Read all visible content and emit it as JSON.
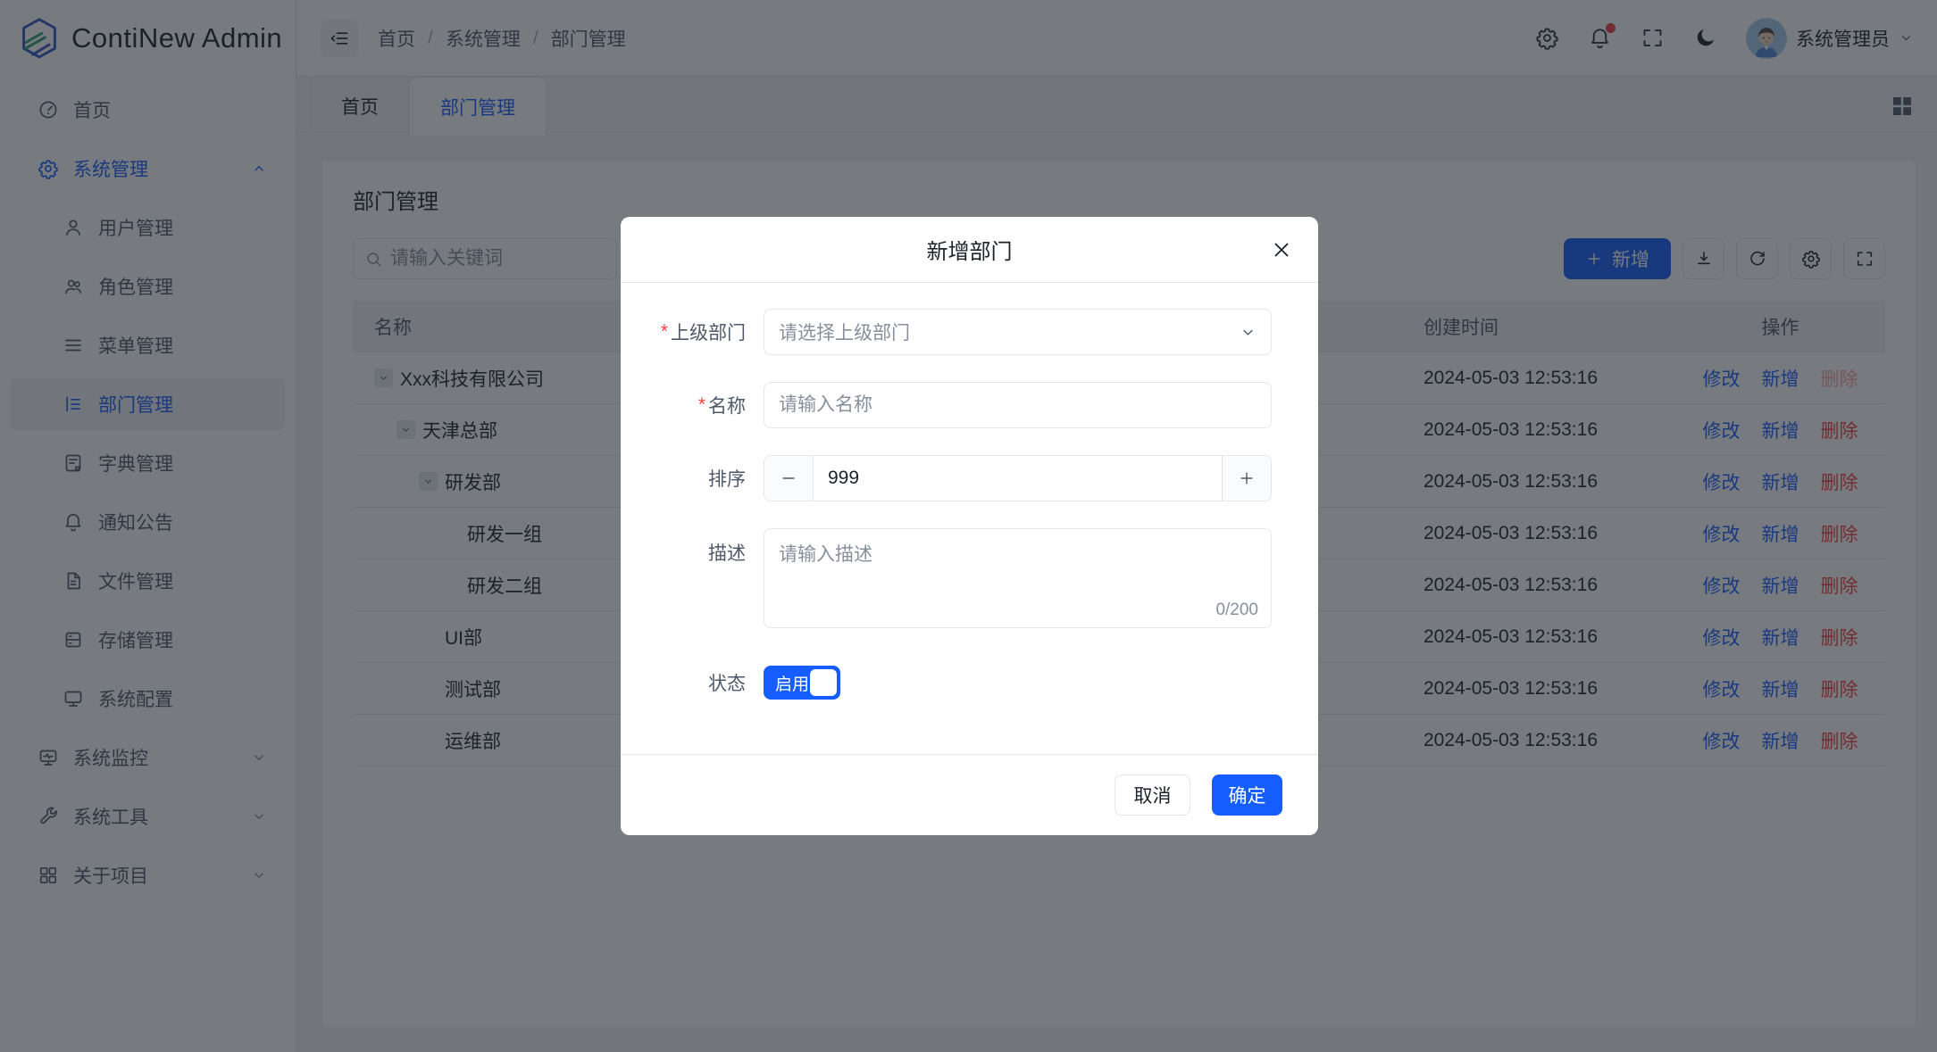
{
  "app": {
    "title": "ContiNew Admin"
  },
  "colors": {
    "primary": "#165DFF",
    "danger": "#F53F3F"
  },
  "breadcrumb": {
    "items": [
      "首页",
      "系统管理",
      "部门管理"
    ],
    "separator": "/"
  },
  "header": {
    "icons": [
      "settings-icon",
      "notification-icon",
      "fullscreen-icon",
      "dark-mode-icon"
    ],
    "user": {
      "name": "系统管理员"
    }
  },
  "tabs": {
    "items": [
      {
        "label": "首页"
      },
      {
        "label": "部门管理"
      }
    ]
  },
  "sidebar": {
    "items": [
      {
        "label": "首页",
        "icon": "dashboard",
        "level": 0
      },
      {
        "label": "系统管理",
        "icon": "gear",
        "level": 0,
        "active": true,
        "expanded": true
      },
      {
        "label": "用户管理",
        "icon": "user",
        "level": 1
      },
      {
        "label": "角色管理",
        "icon": "users",
        "level": 1
      },
      {
        "label": "菜单管理",
        "icon": "menu",
        "level": 1
      },
      {
        "label": "部门管理",
        "icon": "tree",
        "level": 1,
        "selected": true
      },
      {
        "label": "字典管理",
        "icon": "dict",
        "level": 1
      },
      {
        "label": "通知公告",
        "icon": "bell",
        "level": 1
      },
      {
        "label": "文件管理",
        "icon": "file",
        "level": 1
      },
      {
        "label": "存储管理",
        "icon": "storage",
        "level": 1
      },
      {
        "label": "系统配置",
        "icon": "config",
        "level": 1
      },
      {
        "label": "系统监控",
        "icon": "monitor",
        "level": 0,
        "collapsible": true
      },
      {
        "label": "系统工具",
        "icon": "wrench",
        "level": 0,
        "collapsible": true
      },
      {
        "label": "关于项目",
        "icon": "grid",
        "level": 0,
        "collapsible": true
      }
    ]
  },
  "page": {
    "title": "部门管理",
    "search_placeholder": "请输入关键词",
    "toolbar": {
      "add_label": "新增"
    }
  },
  "table": {
    "columns": [
      "名称",
      "创建时间",
      "操作"
    ],
    "actions": [
      "修改",
      "新增",
      "删除"
    ],
    "rows": [
      {
        "name": "Xxx科技有限公司",
        "level": 0,
        "expandable": true,
        "created": "2024-05-03 12:53:16",
        "delete_disabled": true
      },
      {
        "name": "天津总部",
        "level": 1,
        "expandable": true,
        "created": "2024-05-03 12:53:16",
        "delete_disabled": false
      },
      {
        "name": "研发部",
        "level": 2,
        "expandable": true,
        "created": "2024-05-03 12:53:16",
        "delete_disabled": false
      },
      {
        "name": "研发一组",
        "level": 3,
        "expandable": false,
        "created": "2024-05-03 12:53:16",
        "delete_disabled": false
      },
      {
        "name": "研发二组",
        "level": 3,
        "expandable": false,
        "created": "2024-05-03 12:53:16",
        "delete_disabled": false
      },
      {
        "name": "UI部",
        "level": 2,
        "expandable": false,
        "created": "2024-05-03 12:53:16",
        "delete_disabled": false
      },
      {
        "name": "测试部",
        "level": 2,
        "expandable": false,
        "created": "2024-05-03 12:53:16",
        "delete_disabled": false
      },
      {
        "name": "运维部",
        "level": 2,
        "expandable": false,
        "created": "2024-05-03 12:53:16",
        "delete_disabled": false
      }
    ]
  },
  "modal": {
    "title": "新增部门",
    "fields": {
      "parent": {
        "label": "上级部门",
        "required": true,
        "placeholder": "请选择上级部门"
      },
      "name": {
        "label": "名称",
        "required": true,
        "placeholder": "请输入名称"
      },
      "sort": {
        "label": "排序",
        "value": "999"
      },
      "desc": {
        "label": "描述",
        "placeholder": "请输入描述",
        "counter": "0/200"
      },
      "status": {
        "label": "状态",
        "on_label": "启用",
        "on": true
      }
    },
    "cancel_label": "取消",
    "confirm_label": "确定"
  }
}
